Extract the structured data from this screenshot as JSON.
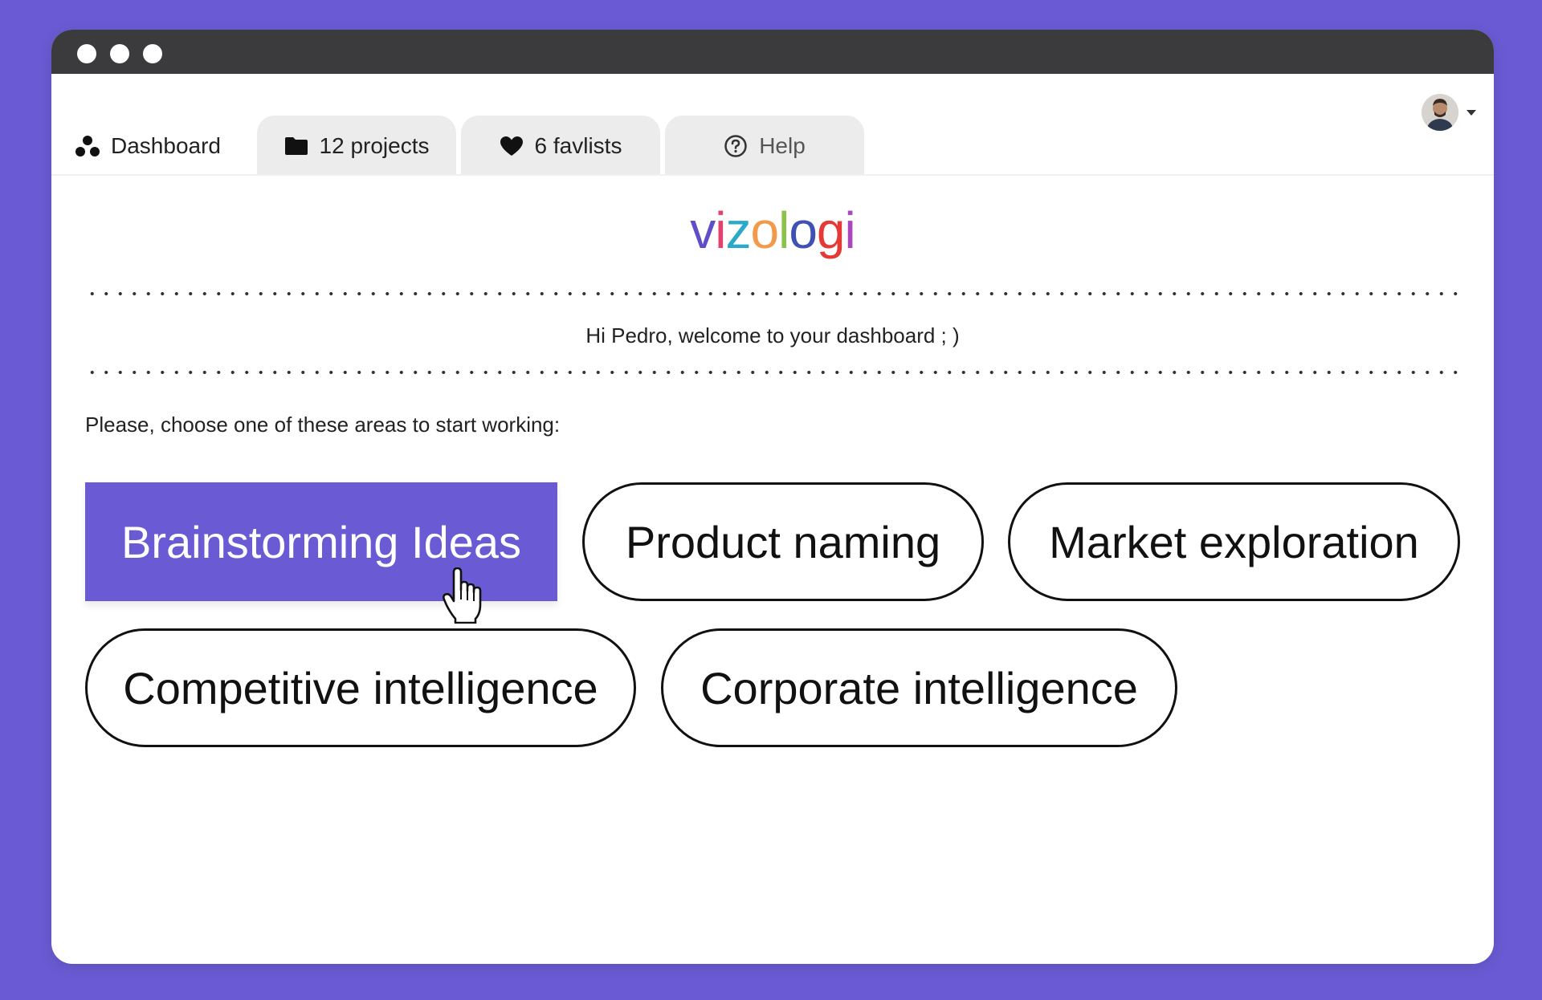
{
  "window": {
    "controls": [
      "close",
      "minimize",
      "maximize"
    ]
  },
  "tabs": [
    {
      "label": "Dashboard",
      "icon": "dashboard-icon",
      "active": true
    },
    {
      "label": "12 projects",
      "icon": "folder-icon",
      "active": false
    },
    {
      "label": "6 favlists",
      "icon": "heart-icon",
      "active": false
    },
    {
      "label": "Help",
      "icon": "help-circle-icon",
      "active": false
    }
  ],
  "user": {
    "avatar": "user-avatar",
    "menu_icon": "caret-down-icon"
  },
  "logo": {
    "text": "vizologi",
    "letter_colors": [
      "#5e4fc9",
      "#e3426e",
      "#2aa9c9",
      "#f2994a",
      "#8bc34a",
      "#3f51b5",
      "#e53935",
      "#ab47bc"
    ]
  },
  "welcome_text": "Hi Pedro, welcome to your dashboard ; )",
  "prompt_text": "Please, choose one of these areas to start working:",
  "areas": [
    {
      "label": "Brainstorming Ideas",
      "selected": true
    },
    {
      "label": "Product naming",
      "selected": false
    },
    {
      "label": "Market exploration",
      "selected": false
    },
    {
      "label": "Competitive intelligence",
      "selected": false
    },
    {
      "label": "Corporate intelligence",
      "selected": false
    }
  ],
  "colors": {
    "brand_purple": "#6a5bd4",
    "titlebar": "#3b3a3d",
    "tab_inactive": "#ececec",
    "text": "#222222"
  }
}
